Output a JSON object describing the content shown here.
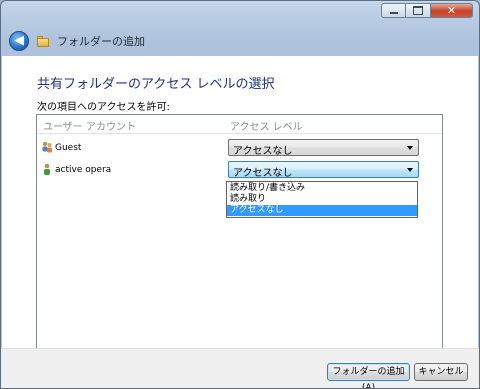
{
  "window": {
    "title": "フォルダーの追加",
    "caption_buttons": [
      "minimize",
      "maximize",
      "close"
    ]
  },
  "main": {
    "heading": "共有フォルダーのアクセス レベルの選択",
    "sub_label": "次の項目へのアクセスを許可:",
    "columns": [
      "ユーザー アカウント",
      "アクセス レベル"
    ],
    "rows": [
      {
        "user": "Guest",
        "icon": "users-group-icon",
        "access": "アクセスなし"
      },
      {
        "user": "active opera",
        "icon": "user-icon",
        "access": "アクセスなし"
      }
    ],
    "dropdown_options": [
      "読み取り/書き込み",
      "読み取り",
      "アクセスなし"
    ],
    "dropdown_selected": "アクセスなし"
  },
  "footer": {
    "add_button": "フォルダーの追加(A)",
    "cancel_button": "キャンセル"
  },
  "colors": {
    "heading": "#1e3287",
    "selection": "#3399ff",
    "titlebar": "#b7cbe2"
  }
}
